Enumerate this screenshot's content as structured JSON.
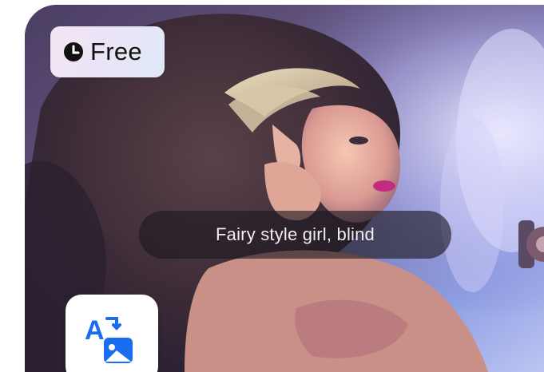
{
  "card": {
    "badge": {
      "label": "Free",
      "icon": "clock-icon"
    },
    "caption": "Fairy style girl, blind",
    "app_tile": {
      "icon": "translate-icon",
      "accent": "#1a6cf0"
    }
  }
}
